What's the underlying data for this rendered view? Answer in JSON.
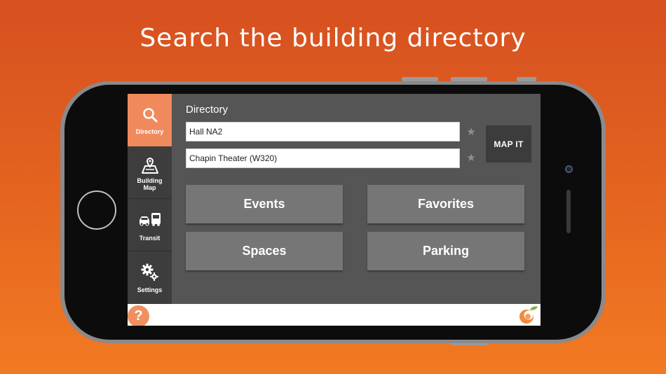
{
  "headline": "Search the building directory",
  "sidebar": {
    "items": [
      {
        "label": "Directory",
        "icon": "search-icon",
        "active": true
      },
      {
        "label_line1": "Building",
        "label_line2": "Map",
        "icon": "map-icon"
      },
      {
        "label": "Transit",
        "icon": "transit-icon"
      },
      {
        "label": "Settings",
        "icon": "gears-icon"
      }
    ]
  },
  "main": {
    "title": "Directory",
    "from_value": "Hall NA2",
    "to_value": "Chapin Theater (W320)",
    "map_it_label": "MAP IT",
    "tiles": [
      "Events",
      "Favorites",
      "Spaces",
      "Parking"
    ]
  },
  "footer": {
    "help_label": "?"
  },
  "colors": {
    "accent": "#f08a5d",
    "sidebar_bg": "#3d3d3d",
    "content_bg": "#555555",
    "tile_bg": "#767676",
    "background_top": "#d65020",
    "background_bottom": "#f27a22"
  }
}
